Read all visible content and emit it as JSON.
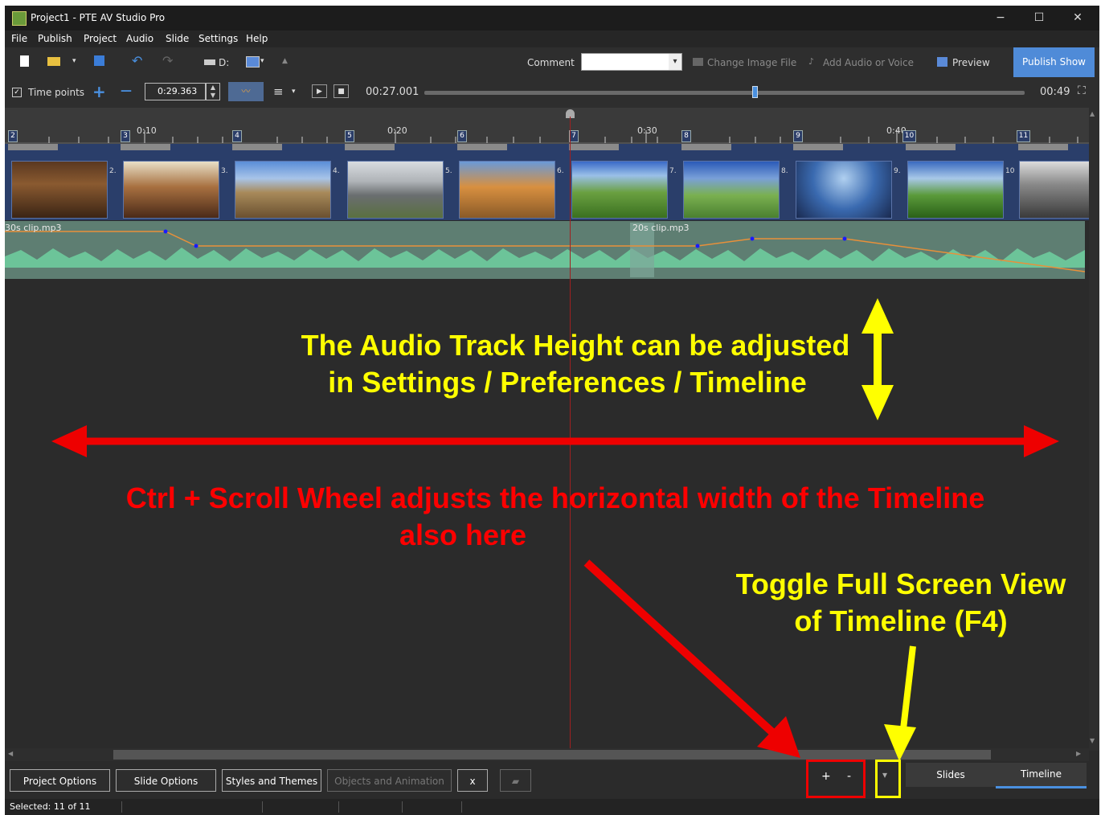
{
  "window": {
    "title": "Project1 - PTE AV Studio Pro",
    "min": "−",
    "max": "☐",
    "close": "✕"
  },
  "menu": [
    "File",
    "Publish",
    "Project",
    "Audio",
    "Slide",
    "Settings",
    "Help"
  ],
  "toolbar1": {
    "drive": "D:",
    "comment_label": "Comment",
    "change_image": "Change Image File",
    "add_audio": "Add Audio or Voice",
    "preview": "Preview",
    "publish": "Publish Show"
  },
  "toolbar2": {
    "timepoints": "Time points",
    "plus": "+",
    "minus": "—",
    "time_value": "0:29.363",
    "current_time": "00:27.001",
    "end_time": "00:49",
    "position_fraction": 0.55
  },
  "ruler": {
    "ticks": [
      "0:10",
      "0:20",
      "0:30",
      "0:40"
    ],
    "slides": [
      "2",
      "3",
      "4",
      "5",
      "6",
      "7",
      "8",
      "9",
      "10",
      "11"
    ]
  },
  "thumbs": {
    "numbers": [
      "2.",
      "3.",
      "4.",
      "5.",
      "6.",
      "7.",
      "8.",
      "9.",
      "10"
    ]
  },
  "audio": {
    "clip1": "30s clip.mp3",
    "clip2": "20s clip.mp3"
  },
  "annotations": {
    "yellow1_line1": "The Audio Track Height can be adjusted",
    "yellow1_line2": "in Settings / Preferences / Timeline",
    "red_line1": "Ctrl + Scroll Wheel adjusts the horizontal width of the Timeline",
    "red_line2": "also here",
    "yellow2_line1": "Toggle Full Screen View",
    "yellow2_line2": "of Timeline (F4)",
    "yellow": "#ffff00",
    "red": "#ff0000"
  },
  "bottom": {
    "project_options": "Project Options",
    "slide_options": "Slide Options",
    "styles_themes": "Styles and Themes",
    "objects_animation": "Objects and Animation",
    "x": "x",
    "zoom_plus": "+",
    "zoom_minus": "-",
    "toggle": "▾",
    "tab_slides": "Slides",
    "tab_timeline": "Timeline"
  },
  "status": {
    "selected": "Selected: 11 of 11"
  }
}
